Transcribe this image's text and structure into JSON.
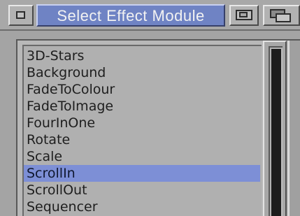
{
  "window": {
    "title": "Select Effect Module"
  },
  "list": {
    "items": [
      "3D-Stars",
      "Background",
      "FadeToColour",
      "FadeToImage",
      "FourInOne",
      "Rotate",
      "Scale",
      "ScrollIn",
      "ScrollOut",
      "Sequencer"
    ],
    "selected": "ScrollIn"
  },
  "scrollbar": {
    "visible_fraction": 1.0
  },
  "colors": {
    "title_active": "#6f83c4",
    "selection": "#7d8fd6",
    "window_bg": "#a4a4a4"
  },
  "icons": {
    "close": "close-gadget-icon",
    "zoom": "zoom-gadget-icon",
    "depth": "depth-gadget-icon"
  }
}
